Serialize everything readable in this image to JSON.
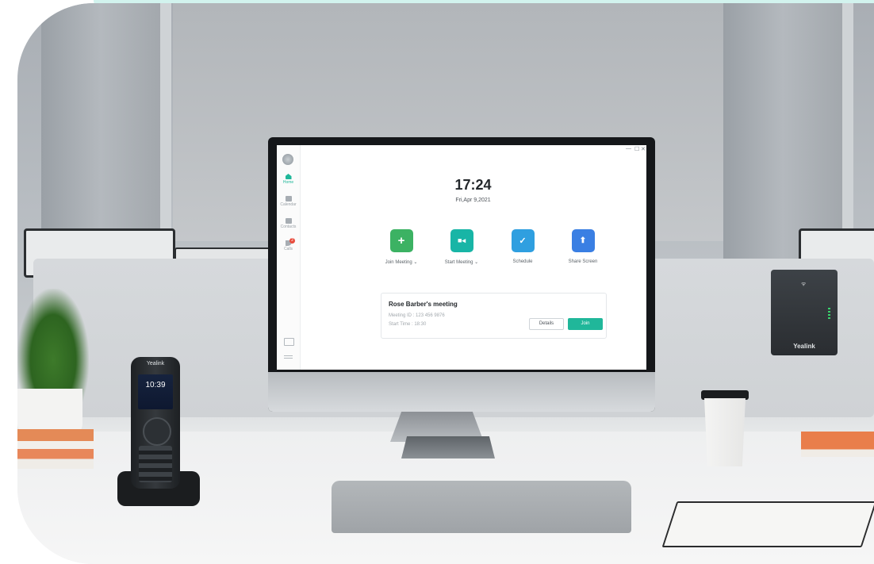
{
  "app": {
    "sidebar": {
      "items": [
        {
          "label": "Home",
          "icon": "home-icon",
          "active": true
        },
        {
          "label": "Calendar",
          "icon": "calendar-icon",
          "active": false
        },
        {
          "label": "Contacts",
          "icon": "contacts-icon",
          "active": false
        },
        {
          "label": "Calls",
          "icon": "phone-icon",
          "active": false,
          "badge": "2"
        }
      ],
      "bottom_icons": [
        "folder-icon",
        "menu-icon"
      ]
    },
    "window_controls": {
      "minimize": "—",
      "maximize": "☐",
      "close": "✕"
    },
    "time": "17:24",
    "date": "Fri,Apr 9,2021",
    "actions": [
      {
        "label": "Join Meeting ⌄",
        "icon": "plus-icon",
        "glyph": "+",
        "color": "#3cb263"
      },
      {
        "label": "Start Meeting ⌄",
        "icon": "video-camera-icon",
        "glyph": "■◂",
        "color": "#18b5a6"
      },
      {
        "label": "Schedule",
        "icon": "calendar-check-icon",
        "glyph": "✓",
        "color": "#2f9fe0"
      },
      {
        "label": "Share Screen",
        "icon": "share-screen-icon",
        "glyph": "⬆",
        "color": "#3a7fe3"
      }
    ],
    "meeting": {
      "title": "Rose Barber's meeting",
      "id_line": "Meeting ID : 123 456 9876",
      "time_line": "Start Time : 18:30",
      "details_label": "Details",
      "join_label": "Join"
    },
    "accent": "#20b79a"
  },
  "handset": {
    "brand": "Yealink",
    "time": "10:39"
  },
  "base_station": {
    "brand": "Yealink"
  }
}
